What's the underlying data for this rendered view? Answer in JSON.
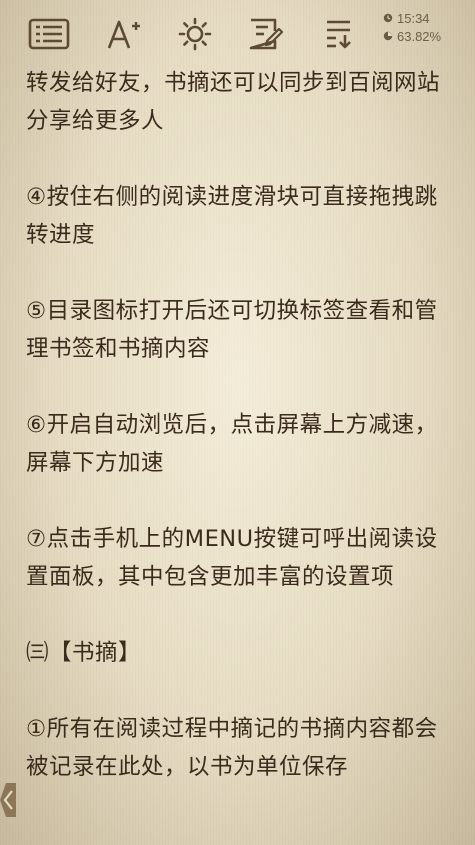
{
  "toolbar": {
    "buttons": [
      {
        "icon": "table-of-contents-icon"
      },
      {
        "icon": "font-size-icon"
      },
      {
        "icon": "brightness-icon"
      },
      {
        "icon": "notes-icon"
      },
      {
        "icon": "settings-icon"
      }
    ]
  },
  "status": {
    "time": "15:34",
    "progress": "63.82%"
  },
  "content": {
    "paragraphs": [
      "转发给好友，书摘还可以同步到百阅网站分享给更多人",
      "④按住右侧的阅读进度滑块可直接拖拽跳转进度",
      "⑤目录图标打开后还可切换标签查看和管理书签和书摘内容",
      "⑥开启自动浏览后，点击屏幕上方减速，屏幕下方加速",
      "⑦点击手机上的MENU按键可呼出阅读设置面板，其中包含更加丰富的设置项",
      "㈢【书摘】",
      "①所有在阅读过程中摘记的书摘内容都会被记录在此处，以书为单位保存"
    ]
  },
  "colors": {
    "background": "#e6dcc3",
    "text": "#3b2b1d",
    "icon": "#5c4a35"
  }
}
